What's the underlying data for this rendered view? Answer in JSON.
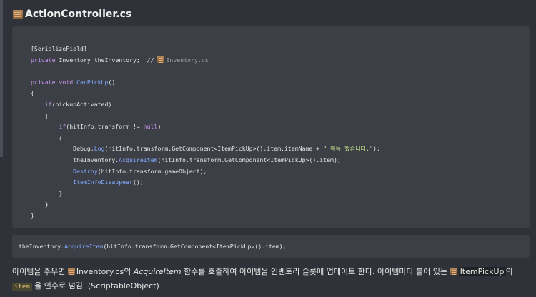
{
  "title": "ActionController.cs",
  "code": {
    "l1": "[SerializeField]",
    "l2_kw": "private",
    "l2_rest": " Inventory theInventory;  // ",
    "l2_comment": "Inventory.cs",
    "l4_kw1": "private",
    "l4_kw2": "void",
    "l4_fn": "CanPickUp",
    "l4_rest": "()",
    "l5": "{",
    "l6_kw": "if",
    "l6_rest": "(pickupActivated)",
    "l7": "{",
    "l8_kw": "if",
    "l8_rest": "(hitInfo.transform != ",
    "l8_null": "null",
    "l8_end": ")",
    "l9": "{",
    "l10_a": "Debug.",
    "l10_fn": "Log",
    "l10_b": "(hitInfo.transform.GetComponent<ItemPickUp>().item.itemName + ",
    "l10_str": "\" 획득 했습니다.\"",
    "l10_c": ");",
    "l11_a": "theInventory.",
    "l11_fn": "AcquireItem",
    "l11_b": "(hitInfo.transform.GetComponent<ItemPickUp>().item);",
    "l12_fn": "Destroy",
    "l12_b": "(hitInfo.transform.gameObject);",
    "l13_fn": "ItemInfoDisappear",
    "l13_b": "();",
    "l14": "}",
    "l15": "}",
    "l16": "}"
  },
  "snippet": {
    "a": "theInventory.",
    "fn": "AcquireItem",
    "b": "(hitInfo.transform.GetComponent<ItemPickUp>().item);"
  },
  "paragraph": {
    "p1": "아이템을 주우면 ",
    "file1": "Inventory.cs",
    "p2": "의 ",
    "method": "AcquireItem",
    "p3": " 함수를 호출하여 아이템을 인벤토리 슬롯에 업데이트 한다. 아이템마다 붙어 있는 ",
    "file2": "ItemPickUp",
    "p4": "의 ",
    "code": "item",
    "p5": " 을 인수로 넘김. (ScriptableObject)"
  }
}
